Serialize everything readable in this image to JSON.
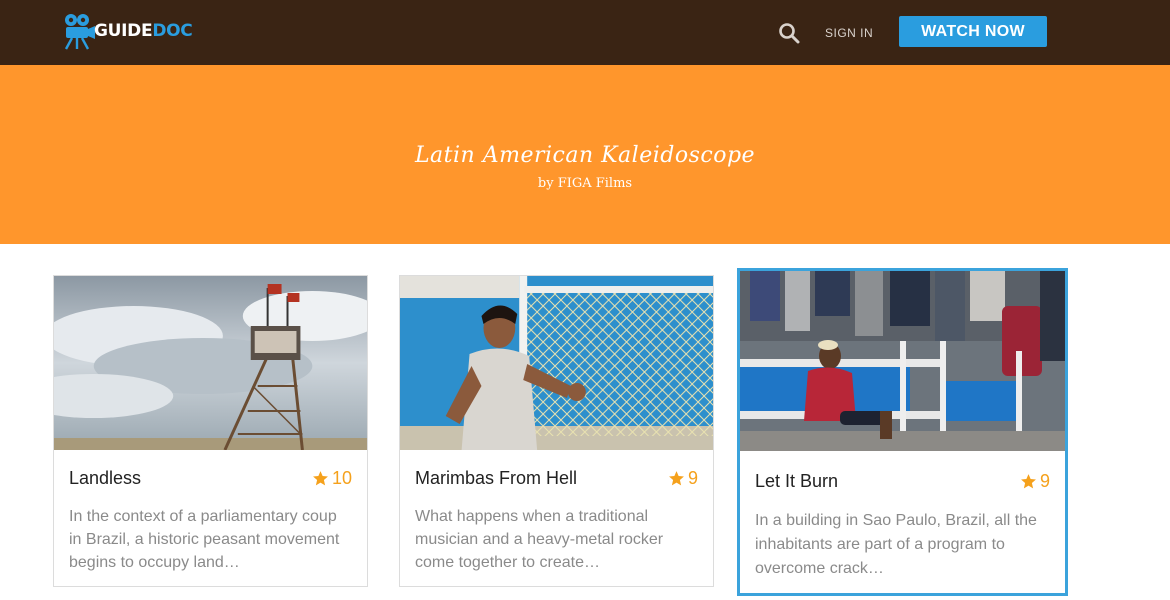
{
  "header": {
    "logo_guide": "GUIDE",
    "logo_doc": "DOC",
    "sign_in": "SIGN IN",
    "watch_now": "WATCH NOW"
  },
  "banner": {
    "title": "Latin American Kaleidoscope",
    "subtitle": "by FIGA Films"
  },
  "cards": [
    {
      "title": "Landless",
      "rating": "10",
      "description": "In the context of a parliamentary coup in Brazil, a historic peasant movement begins to occupy land…"
    },
    {
      "title": "Marimbas From Hell",
      "rating": "9",
      "description": "What happens when a traditional musician and a heavy-metal rocker come together to create…"
    },
    {
      "title": "Let It Burn",
      "rating": "9",
      "description": "In a building in Sao Paulo, Brazil, all the inhabitants are part of a program to overcome crack…"
    }
  ],
  "colors": {
    "header_bg": "#3a2414",
    "accent_blue": "#2a9ddf",
    "banner_orange": "#ff962c",
    "rating_gold": "#f5a11c"
  },
  "icons": {
    "logo": "film-camera-icon",
    "search": "search-icon",
    "rating": "star-icon"
  }
}
